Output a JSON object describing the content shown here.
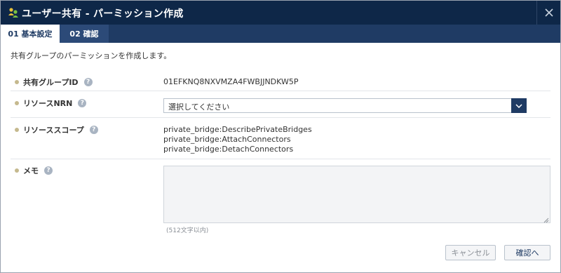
{
  "dialog": {
    "title": "ユーザー共有 - パーミッション作成",
    "close_glyph": "×"
  },
  "tabs": [
    {
      "label": "01 基本設定",
      "active": true
    },
    {
      "label": "02 確認",
      "active": false
    }
  ],
  "intro": "共有グループのパーミッションを作成します。",
  "fields": {
    "group_id": {
      "label": "共有グループID",
      "help": "?",
      "value": "01EFKNQ8NXVMZA4FWBJJNDKW5P"
    },
    "nrn": {
      "label": "リソースNRN",
      "help": "?",
      "selected": "選択してください"
    },
    "scope": {
      "label": "リソーススコープ",
      "help": "?",
      "values": [
        "private_bridge:DescribePrivateBridges",
        "private_bridge:AttachConnectors",
        "private_bridge:DetachConnectors"
      ]
    },
    "memo": {
      "label": "メモ",
      "help": "?",
      "value": "",
      "hint": "(512文字以内)"
    }
  },
  "buttons": {
    "cancel": "キャンセル",
    "confirm": "確認へ"
  },
  "colors": {
    "titlebar": "#0e2748",
    "tabbar": "#1f3b64",
    "bullet": "#c5b98e",
    "help_icon": "#a9b4c2"
  },
  "icons": {
    "app": "people-group-icon",
    "close": "close-icon",
    "help": "question-circle-icon",
    "dropdown": "chevron-down-icon"
  }
}
